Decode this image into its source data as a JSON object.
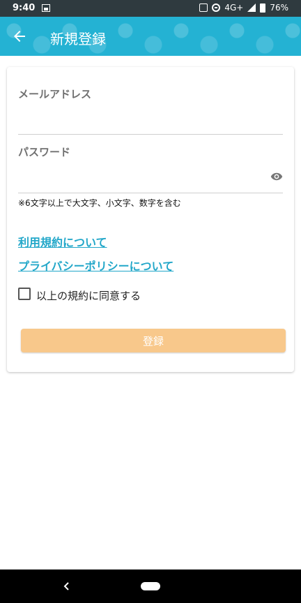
{
  "status_bar": {
    "time": "9:40",
    "network": "4G+",
    "battery": "76%"
  },
  "app_bar": {
    "title": "新規登録",
    "color": "#24b2d3"
  },
  "form": {
    "email_label": "メールアドレス",
    "password_label": "パスワード",
    "password_hint": "※6文字以上で大文字、小文字、数字を含む",
    "terms_link": "利用規約について",
    "privacy_link": "プライバシーポリシーについて",
    "agree_label": "以上の規約に同意する",
    "submit_label": "登録",
    "submit_color": "#f8c88b",
    "link_color": "#22a7c9"
  },
  "icons": {
    "back": "arrow-left-icon",
    "eye": "eye-icon",
    "nav_back": "nav-back-icon",
    "nav_home": "nav-home-pill"
  }
}
